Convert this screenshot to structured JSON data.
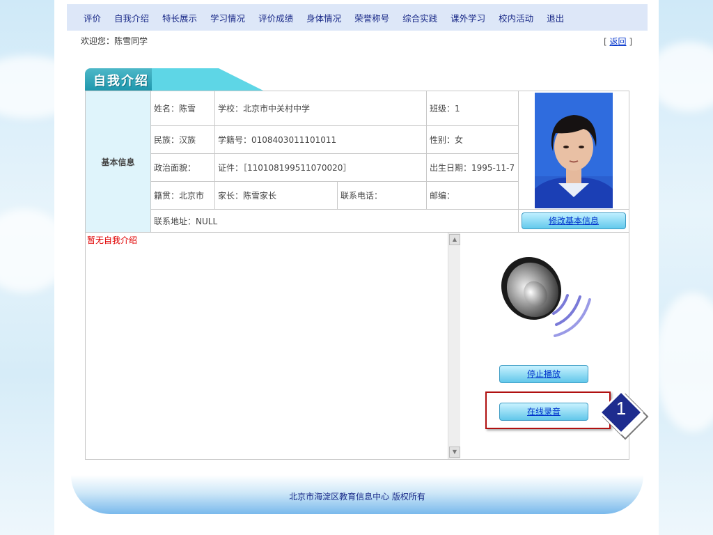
{
  "nav": {
    "items": [
      "评价",
      "自我介绍",
      "特长展示",
      "学习情况",
      "评价成绩",
      "身体情况",
      "荣誉称号",
      "综合实践",
      "课外学习",
      "校内活动",
      "退出"
    ]
  },
  "header": {
    "welcome": "欢迎您：陈雪同学",
    "back_prefix": "[",
    "back_label": "返回",
    "back_suffix": "]"
  },
  "section": {
    "title": "自我介绍"
  },
  "basic_info": {
    "label": "基本信息",
    "name": "姓名：陈雪",
    "school": "学校：北京市中关村中学",
    "class": "班级：1",
    "ethnicity": "民族：汉族",
    "student_id": "学籍号：0108403011101011",
    "gender": "性别：女",
    "political": "政治面貌：",
    "id_card": "证件：［110108199511070020］",
    "birth": "出生日期：1995-11-7",
    "native": "籍贯：北京市",
    "parent": "家长：陈雪家长",
    "phone": "联系电话：",
    "postcode": "邮编：",
    "address": "联系地址：NULL",
    "edit_button": "修改基本信息"
  },
  "intro": {
    "empty_text": "暂无自我介绍"
  },
  "media": {
    "stop_button": "停止播放",
    "record_button": "在线录音"
  },
  "annotation": {
    "marker": "1"
  },
  "footer": {
    "text": "北京市海淀区教育信息中心 版权所有"
  },
  "icons": [
    "speaker-icon",
    "scroll-up-icon",
    "scroll-down-icon",
    "student-photo"
  ]
}
